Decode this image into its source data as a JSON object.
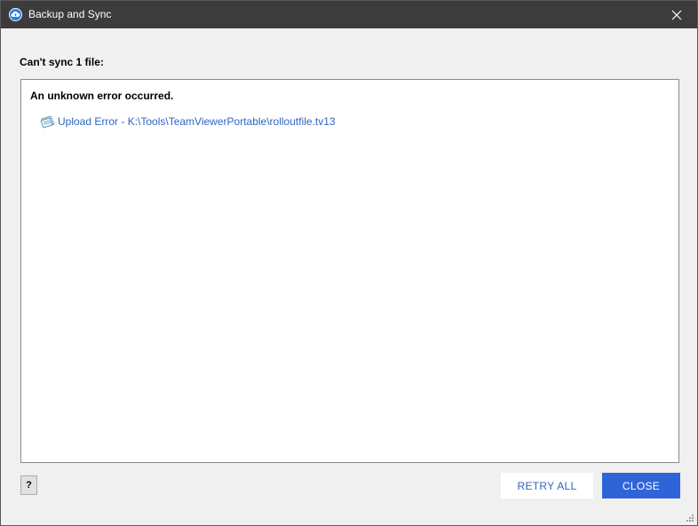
{
  "window": {
    "title": "Backup and Sync"
  },
  "content": {
    "heading": "Can't sync 1 file:",
    "error_title": "An unknown error occurred.",
    "errors": [
      {
        "icon": "document-icon",
        "text": "Upload Error - K:\\Tools\\TeamViewerPortable\\rolloutfile.tv13"
      }
    ]
  },
  "footer": {
    "help_label": "?",
    "retry_label": "RETRY ALL",
    "close_label": "CLOSE"
  },
  "colors": {
    "titlebar": "#3c3c3c",
    "accent": "#2f64d8",
    "link": "#2f64c4"
  }
}
